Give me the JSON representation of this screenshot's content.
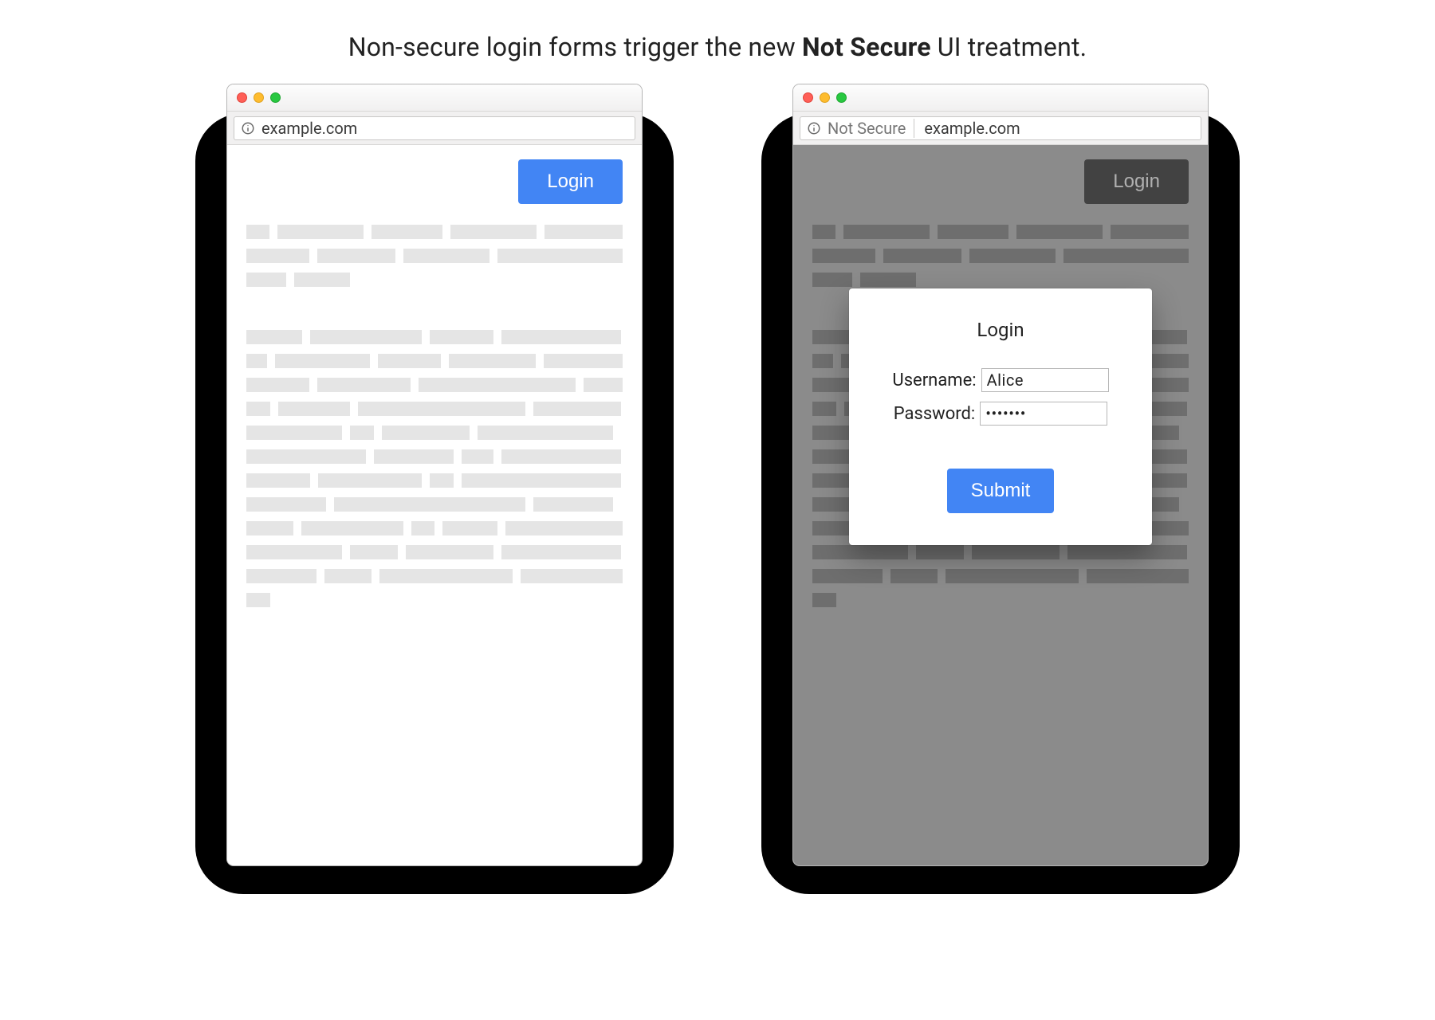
{
  "caption": {
    "prefix": "Non-secure login forms trigger the new ",
    "bold": "Not Secure",
    "suffix": " UI treatment."
  },
  "left": {
    "address": "example.com",
    "login_button": "Login"
  },
  "right": {
    "not_secure_label": "Not Secure",
    "address": "example.com",
    "login_button": "Login",
    "modal": {
      "title": "Login",
      "username_label": "Username:",
      "username_value": "Alice",
      "password_label": "Password:",
      "password_display": "•••••••",
      "submit": "Submit"
    }
  },
  "colors": {
    "accent": "#4285f4",
    "dim_bg": "#8b8b8b"
  }
}
